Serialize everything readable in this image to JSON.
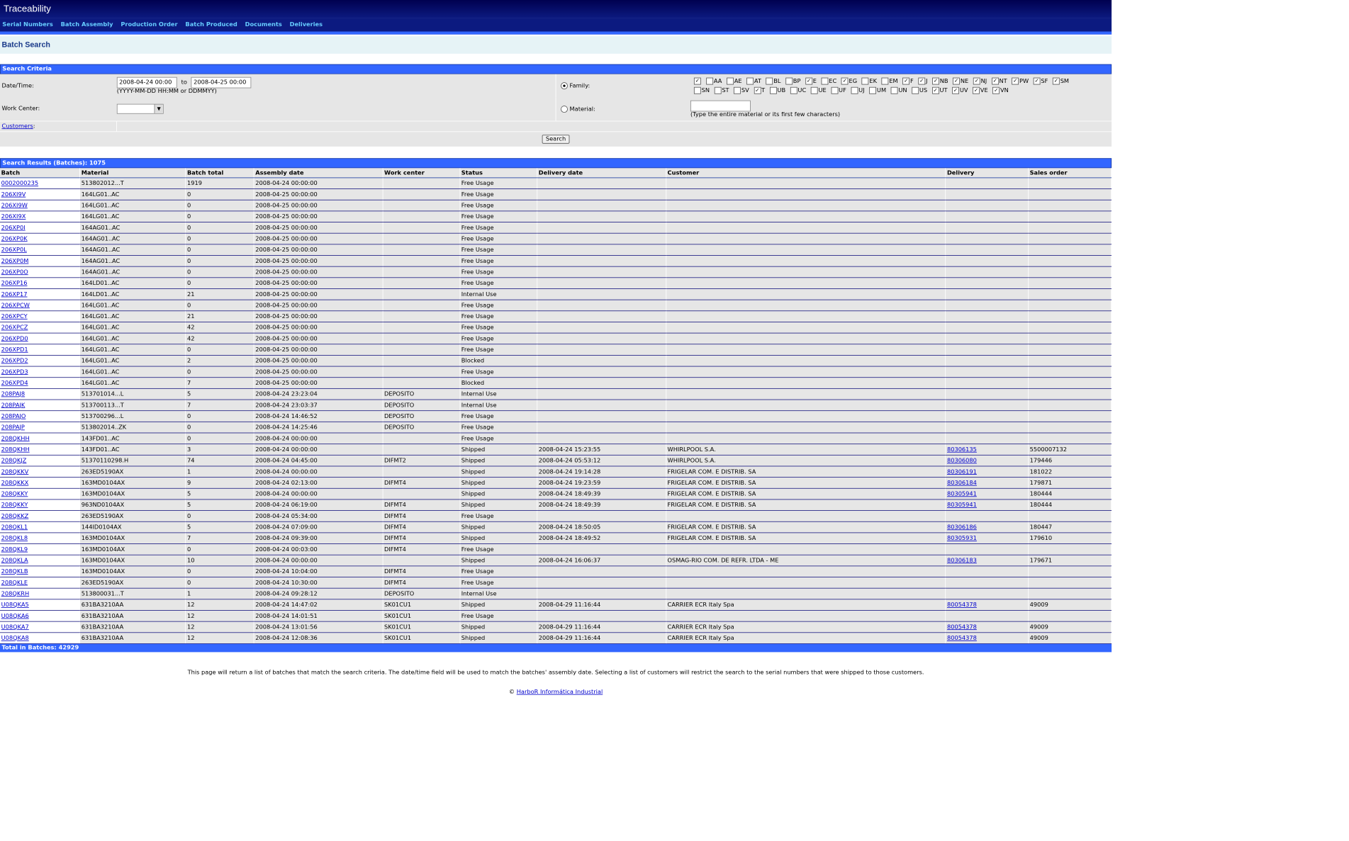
{
  "app": {
    "title": "Traceability"
  },
  "nav": [
    "Serial Numbers",
    "Batch Assembly",
    "Production Order",
    "Batch Produced",
    "Documents",
    "Deliveries"
  ],
  "page_title": "Batch Search",
  "criteria": {
    "section_label": "Search Criteria",
    "datetime_label": "Date/Time:",
    "date_from": "2008-04-24 00:00",
    "to_label": "to",
    "date_to": "2008-04-25 00:00",
    "date_hint": "(YYYY-MM-DD HH:MM or DDMMYY)",
    "workcenter_label": "Work Center:",
    "workcenter_value": "",
    "customers_label": "Customers",
    "family_label": "Family:",
    "family_selected": true,
    "material_label": "Material:",
    "material_value": "",
    "material_hint": "(Type the entire material or its first few characters)",
    "search_button": "Search",
    "families_row1": [
      {
        "code": "",
        "checked": true
      },
      {
        "code": "AA",
        "checked": false
      },
      {
        "code": "AE",
        "checked": false
      },
      {
        "code": "AT",
        "checked": false
      },
      {
        "code": "BL",
        "checked": false
      },
      {
        "code": "BP",
        "checked": false
      },
      {
        "code": "E",
        "checked": true
      },
      {
        "code": "EC",
        "checked": false
      },
      {
        "code": "EG",
        "checked": true
      },
      {
        "code": "EK",
        "checked": false
      },
      {
        "code": "EM",
        "checked": false
      },
      {
        "code": "F",
        "checked": true
      },
      {
        "code": "J",
        "checked": true
      },
      {
        "code": "NB",
        "checked": true
      },
      {
        "code": "NE",
        "checked": true
      },
      {
        "code": "NJ",
        "checked": true
      },
      {
        "code": "NT",
        "checked": true
      },
      {
        "code": "PW",
        "checked": true
      },
      {
        "code": "SF",
        "checked": true
      },
      {
        "code": "SM",
        "checked": true
      }
    ],
    "families_row2": [
      {
        "code": "SN",
        "checked": false
      },
      {
        "code": "ST",
        "checked": false
      },
      {
        "code": "SV",
        "checked": false
      },
      {
        "code": "T",
        "checked": true
      },
      {
        "code": "UB",
        "checked": false
      },
      {
        "code": "UC",
        "checked": false
      },
      {
        "code": "UE",
        "checked": false
      },
      {
        "code": "UF",
        "checked": false
      },
      {
        "code": "UJ",
        "checked": false
      },
      {
        "code": "UM",
        "checked": false
      },
      {
        "code": "UN",
        "checked": false
      },
      {
        "code": "US",
        "checked": false
      },
      {
        "code": "UT",
        "checked": true
      },
      {
        "code": "UV",
        "checked": true
      },
      {
        "code": "VE",
        "checked": true
      },
      {
        "code": "VN",
        "checked": true
      }
    ]
  },
  "results": {
    "section_label": "Search Results (Batches): 1075",
    "columns": [
      "Batch",
      "Material",
      "Batch total",
      "Assembly date",
      "Work center",
      "Status",
      "Delivery date",
      "Customer",
      "Delivery",
      "Sales order"
    ],
    "rows": [
      [
        "0002000235",
        "513802012...T",
        "1919",
        "2008-04-24 00:00:00",
        "",
        "Free Usage",
        "",
        "",
        "",
        ""
      ],
      [
        "206XI9V",
        "164LG01..AC",
        "0",
        "2008-04-25 00:00:00",
        "",
        "Free Usage",
        "",
        "",
        "",
        ""
      ],
      [
        "206XI9W",
        "164LG01..AC",
        "0",
        "2008-04-25 00:00:00",
        "",
        "Free Usage",
        "",
        "",
        "",
        ""
      ],
      [
        "206XI9X",
        "164LG01..AC",
        "0",
        "2008-04-25 00:00:00",
        "",
        "Free Usage",
        "",
        "",
        "",
        ""
      ],
      [
        "206XP0I",
        "164AG01..AC",
        "0",
        "2008-04-25 00:00:00",
        "",
        "Free Usage",
        "",
        "",
        "",
        ""
      ],
      [
        "206XP0K",
        "164AG01..AC",
        "0",
        "2008-04-25 00:00:00",
        "",
        "Free Usage",
        "",
        "",
        "",
        ""
      ],
      [
        "206XP0L",
        "164AG01..AC",
        "0",
        "2008-04-25 00:00:00",
        "",
        "Free Usage",
        "",
        "",
        "",
        ""
      ],
      [
        "206XP0M",
        "164AG01..AC",
        "0",
        "2008-04-25 00:00:00",
        "",
        "Free Usage",
        "",
        "",
        "",
        ""
      ],
      [
        "206XP0O",
        "164AG01..AC",
        "0",
        "2008-04-25 00:00:00",
        "",
        "Free Usage",
        "",
        "",
        "",
        ""
      ],
      [
        "206XP16",
        "164LD01..AC",
        "0",
        "2008-04-25 00:00:00",
        "",
        "Free Usage",
        "",
        "",
        "",
        ""
      ],
      [
        "206XP17",
        "164LD01..AC",
        "21",
        "2008-04-25 00:00:00",
        "",
        "Internal Use",
        "",
        "",
        "",
        ""
      ],
      [
        "206XPCW",
        "164LG01..AC",
        "0",
        "2008-04-25 00:00:00",
        "",
        "Free Usage",
        "",
        "",
        "",
        ""
      ],
      [
        "206XPCY",
        "164LG01..AC",
        "21",
        "2008-04-25 00:00:00",
        "",
        "Free Usage",
        "",
        "",
        "",
        ""
      ],
      [
        "206XPCZ",
        "164LG01..AC",
        "42",
        "2008-04-25 00:00:00",
        "",
        "Free Usage",
        "",
        "",
        "",
        ""
      ],
      [
        "206XPD0",
        "164LG01..AC",
        "42",
        "2008-04-25 00:00:00",
        "",
        "Free Usage",
        "",
        "",
        "",
        ""
      ],
      [
        "206XPD1",
        "164LG01..AC",
        "0",
        "2008-04-25 00:00:00",
        "",
        "Free Usage",
        "",
        "",
        "",
        ""
      ],
      [
        "206XPD2",
        "164LG01..AC",
        "2",
        "2008-04-25 00:00:00",
        "",
        "Blocked",
        "",
        "",
        "",
        ""
      ],
      [
        "206XPD3",
        "164LG01..AC",
        "0",
        "2008-04-25 00:00:00",
        "",
        "Free Usage",
        "",
        "",
        "",
        ""
      ],
      [
        "206XPD4",
        "164LG01..AC",
        "7",
        "2008-04-25 00:00:00",
        "",
        "Blocked",
        "",
        "",
        "",
        ""
      ],
      [
        "208PAJ8",
        "513701014...L",
        "5",
        "2008-04-24 23:23:04",
        "DEPOSITO",
        "Internal Use",
        "",
        "",
        "",
        ""
      ],
      [
        "208PAJK",
        "513700113...T",
        "7",
        "2008-04-24 23:03:37",
        "DEPOSITO",
        "Internal Use",
        "",
        "",
        "",
        ""
      ],
      [
        "208PAJO",
        "513700296...L",
        "0",
        "2008-04-24 14:46:52",
        "DEPOSITO",
        "Free Usage",
        "",
        "",
        "",
        ""
      ],
      [
        "208PAJP",
        "513802014..ZK",
        "0",
        "2008-04-24 14:25:46",
        "DEPOSITO",
        "Free Usage",
        "",
        "",
        "",
        ""
      ],
      [
        "208QKHH",
        "143FD01..AC",
        "0",
        "2008-04-24 00:00:00",
        "",
        "Free Usage",
        "",
        "",
        "",
        ""
      ],
      [
        "208QKHH",
        "143FD01..AC",
        "3",
        "2008-04-24 00:00:00",
        "",
        "Shipped",
        "2008-04-24 15:23:55",
        "WHIRLPOOL S.A.",
        "80306135",
        "5500007132"
      ],
      [
        "208QKJZ",
        "51370110298.H",
        "74",
        "2008-04-24 04:45:00",
        "DIFMT2",
        "Shipped",
        "2008-04-24 05:53:12",
        "WHIRLPOOL S.A.",
        "80306080",
        "179446"
      ],
      [
        "208QKKV",
        "263ED5190AX",
        "1",
        "2008-04-24 00:00:00",
        "",
        "Shipped",
        "2008-04-24 19:14:28",
        "FRIGELAR COM. E DISTRIB. SA",
        "80306191",
        "181022"
      ],
      [
        "208QKKX",
        "163MD0104AX",
        "9",
        "2008-04-24 02:13:00",
        "DIFMT4",
        "Shipped",
        "2008-04-24 19:23:59",
        "FRIGELAR COM. E DISTRIB. SA",
        "80306184",
        "179871"
      ],
      [
        "208QKKY",
        "163MD0104AX",
        "5",
        "2008-04-24 00:00:00",
        "",
        "Shipped",
        "2008-04-24 18:49:39",
        "FRIGELAR COM. E DISTRIB. SA",
        "80305941",
        "180444"
      ],
      [
        "208QKKY",
        "963ND0104AX",
        "5",
        "2008-04-24 06:19:00",
        "DIFMT4",
        "Shipped",
        "2008-04-24 18:49:39",
        "FRIGELAR COM. E DISTRIB. SA",
        "80305941",
        "180444"
      ],
      [
        "208QKKZ",
        "263ED5190AX",
        "0",
        "2008-04-24 05:34:00",
        "DIFMT4",
        "Free Usage",
        "",
        "",
        "",
        ""
      ],
      [
        "208QKL1",
        "144ID0104AX",
        "5",
        "2008-04-24 07:09:00",
        "DIFMT4",
        "Shipped",
        "2008-04-24 18:50:05",
        "FRIGELAR COM. E DISTRIB. SA",
        "80306186",
        "180447"
      ],
      [
        "208QKL8",
        "163MD0104AX",
        "7",
        "2008-04-24 09:39:00",
        "DIFMT4",
        "Shipped",
        "2008-04-24 18:49:52",
        "FRIGELAR COM. E DISTRIB. SA",
        "80305931",
        "179610"
      ],
      [
        "208QKL9",
        "163MD0104AX",
        "0",
        "2008-04-24 00:03:00",
        "DIFMT4",
        "Free Usage",
        "",
        "",
        "",
        ""
      ],
      [
        "208QKLA",
        "163MD0104AX",
        "10",
        "2008-04-24 00:00:00",
        "",
        "Shipped",
        "2008-04-24 16:06:37",
        "OSMAG-RIO COM. DE REFR. LTDA - ME",
        "80306183",
        "179671"
      ],
      [
        "208QKLB",
        "163MD0104AX",
        "0",
        "2008-04-24 10:04:00",
        "DIFMT4",
        "Free Usage",
        "",
        "",
        "",
        ""
      ],
      [
        "208QKLE",
        "263ED5190AX",
        "0",
        "2008-04-24 10:30:00",
        "DIFMT4",
        "Free Usage",
        "",
        "",
        "",
        ""
      ],
      [
        "208QKRH",
        "513800031...T",
        "1",
        "2008-04-24 09:28:12",
        "DEPOSITO",
        "Internal Use",
        "",
        "",
        "",
        ""
      ],
      [
        "U08QKA5",
        "631BA3210AA",
        "12",
        "2008-04-24 14:47:02",
        "SK01CU1",
        "Shipped",
        "2008-04-29 11:16:44",
        "CARRIER ECR Italy Spa",
        "80054378",
        "49009"
      ],
      [
        "U08QKA6",
        "631BA3210AA",
        "12",
        "2008-04-24 14:01:51",
        "SK01CU1",
        "Free Usage",
        "",
        "",
        "",
        ""
      ],
      [
        "U08QKA7",
        "631BA3210AA",
        "12",
        "2008-04-24 13:01:56",
        "SK01CU1",
        "Shipped",
        "2008-04-29 11:16:44",
        "CARRIER ECR Italy Spa",
        "80054378",
        "49009"
      ],
      [
        "U08QKA8",
        "631BA3210AA",
        "12",
        "2008-04-24 12:08:36",
        "SK01CU1",
        "Shipped",
        "2008-04-29 11:16:44",
        "CARRIER ECR Italy Spa",
        "80054378",
        "49009"
      ]
    ],
    "total_label": "Total in Batches: 42929"
  },
  "help_text": "This page will return a list of batches that match the search criteria. The date/time field will be used to match the batches' assembly date. Selecting a list of customers will restrict the search to the serial numbers that were shipped to those customers.",
  "footer": {
    "copyright": "©",
    "company": "HarboR Informática Industrial"
  }
}
